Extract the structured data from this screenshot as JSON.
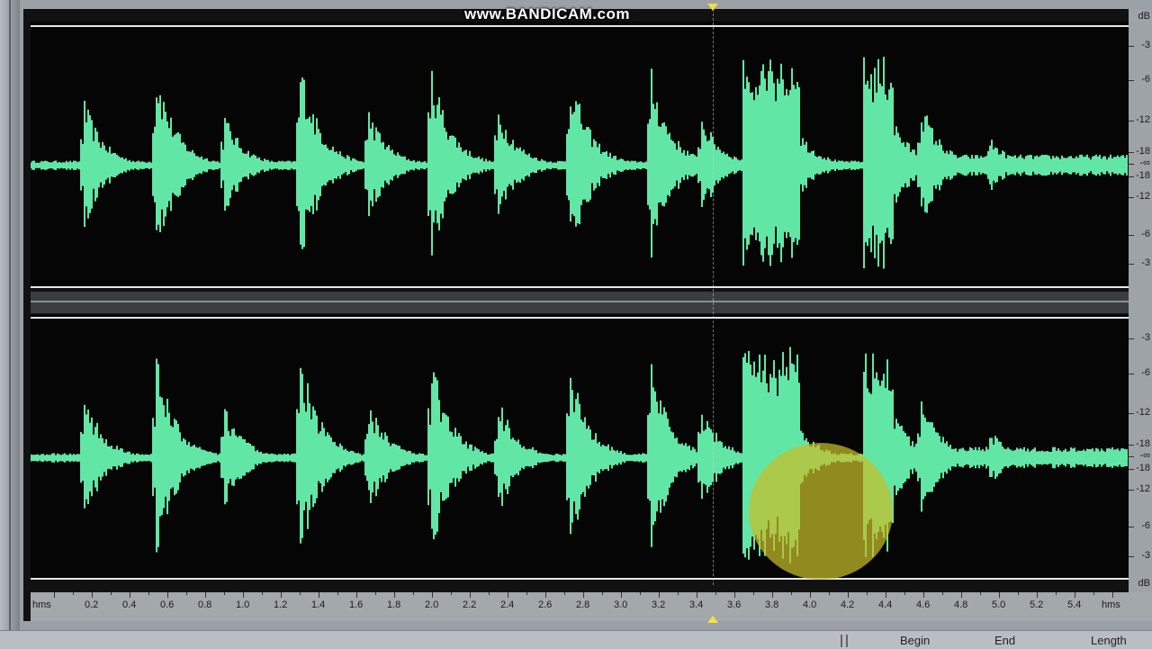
{
  "watermark": "www.BANDICAM.com",
  "db_scale": {
    "unit": "dB",
    "channel1_labels": [
      "-3",
      "-6",
      "-12",
      "-18",
      "-∞",
      "-18",
      "-12",
      "-6",
      "-3"
    ],
    "channel2_labels": [
      "-3",
      "-6",
      "-12",
      "-18",
      "-∞",
      "-18",
      "-12",
      "-6",
      "-3"
    ],
    "bottom_unit": "dB"
  },
  "time_ruler": {
    "left_unit": "hms",
    "right_unit": "hms",
    "ticks": [
      "0.2",
      "0.4",
      "0.6",
      "0.8",
      "1.0",
      "1.2",
      "1.4",
      "1.6",
      "1.8",
      "2.0",
      "2.2",
      "2.4",
      "2.6",
      "2.8",
      "3.0",
      "3.2",
      "3.4",
      "3.6",
      "3.8",
      "4.0",
      "4.2",
      "4.4",
      "4.6",
      "4.8",
      "5.0",
      "5.2",
      "5.4"
    ]
  },
  "playhead_time": 3.6,
  "status": {
    "begin_label": "Begin",
    "end_label": "End",
    "length_label": "Length"
  },
  "colors": {
    "waveform": "#62e6a6",
    "background": "#050505",
    "cursor_highlight": "#c8be28"
  }
}
